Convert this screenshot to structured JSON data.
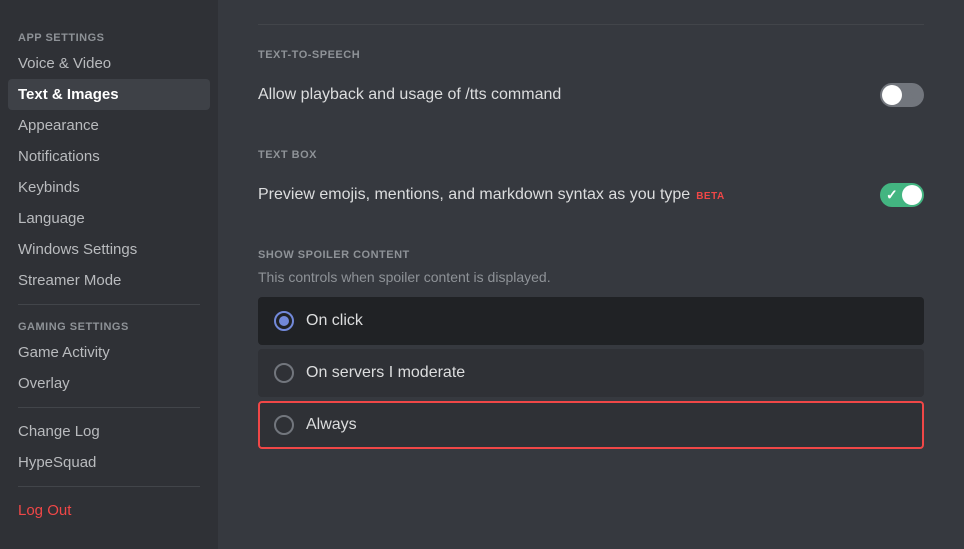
{
  "sidebar": {
    "app_settings_label": "APP SETTINGS",
    "gaming_settings_label": "GAMING SETTINGS",
    "items_app": [
      {
        "id": "voice-video",
        "label": "Voice & Video",
        "active": false
      },
      {
        "id": "text-images",
        "label": "Text & Images",
        "active": true
      },
      {
        "id": "appearance",
        "label": "Appearance",
        "active": false
      },
      {
        "id": "notifications",
        "label": "Notifications",
        "active": false
      },
      {
        "id": "keybinds",
        "label": "Keybinds",
        "active": false
      },
      {
        "id": "language",
        "label": "Language",
        "active": false
      },
      {
        "id": "windows-settings",
        "label": "Windows Settings",
        "active": false
      },
      {
        "id": "streamer-mode",
        "label": "Streamer Mode",
        "active": false
      }
    ],
    "items_gaming": [
      {
        "id": "game-activity",
        "label": "Game Activity",
        "active": false
      },
      {
        "id": "overlay",
        "label": "Overlay",
        "active": false
      }
    ],
    "items_misc": [
      {
        "id": "change-log",
        "label": "Change Log",
        "active": false
      },
      {
        "id": "hypesquad",
        "label": "HypeSquad",
        "active": false
      }
    ],
    "logout_label": "Log Out"
  },
  "main": {
    "tts_section_label": "TEXT-TO-SPEECH",
    "tts_setting_text": "Allow playback and usage of /tts command",
    "tts_toggle_state": "off",
    "textbox_section_label": "TEXT BOX",
    "textbox_setting_text": "Preview emojis, mentions, and markdown syntax as you type",
    "textbox_beta_label": "BETA",
    "textbox_toggle_state": "on",
    "spoiler_section_label": "SHOW SPOILER CONTENT",
    "spoiler_description": "This controls when spoiler content is displayed.",
    "radio_options": [
      {
        "id": "on-click",
        "label": "On click",
        "selected": true,
        "focused": false
      },
      {
        "id": "on-servers-moderate",
        "label": "On servers I moderate",
        "selected": false,
        "focused": false
      },
      {
        "id": "always",
        "label": "Always",
        "selected": false,
        "focused": true
      }
    ]
  }
}
